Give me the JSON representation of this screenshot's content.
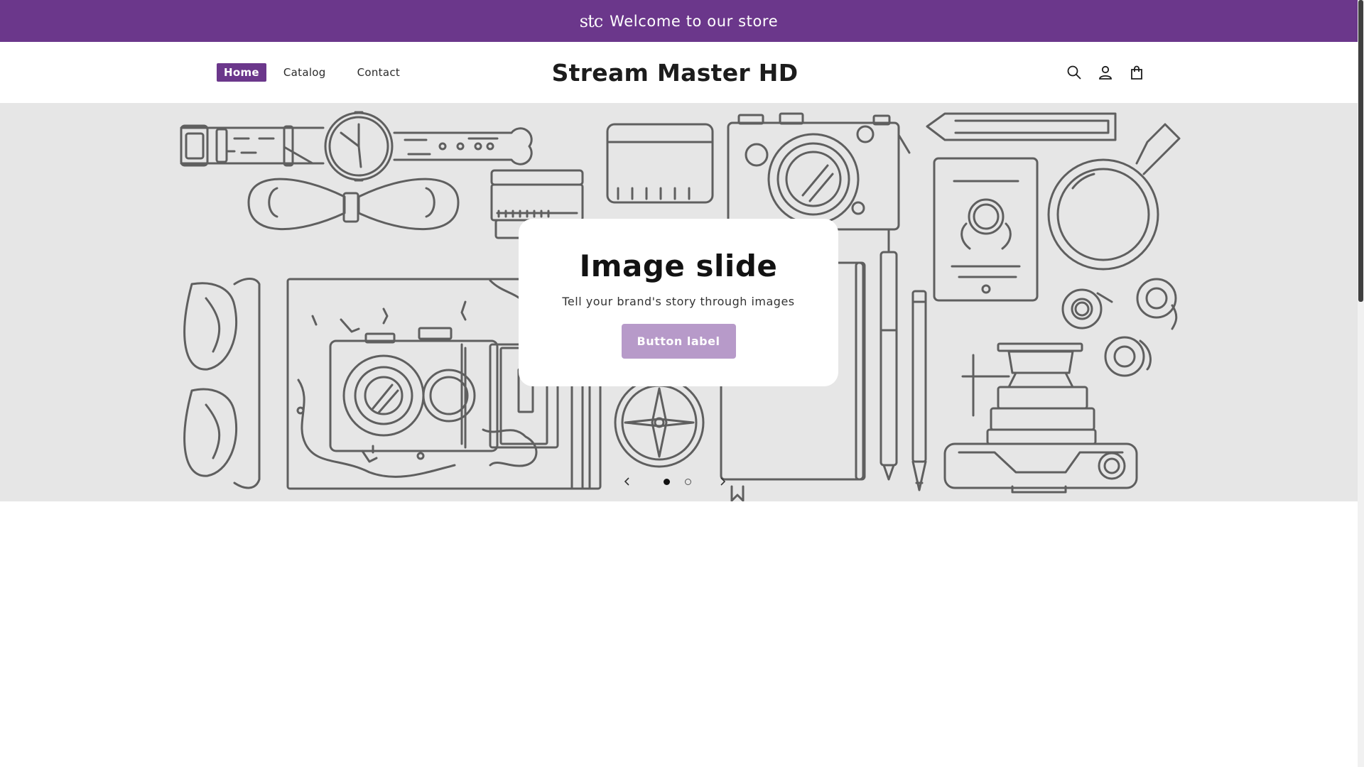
{
  "announcement": {
    "logo": "stc",
    "text": "Welcome to our store"
  },
  "header": {
    "nav": [
      "Home",
      "Catalog",
      "Contact"
    ],
    "active_nav": "Home",
    "store_name": "Stream Master HD",
    "icons": [
      "search-icon",
      "account-icon",
      "cart-icon"
    ]
  },
  "slideshow": {
    "heading": "Image slide",
    "subheading": "Tell your brand's story through images",
    "button_label": "Button label",
    "total_slides": 2,
    "current_slide": 1
  },
  "colors": {
    "brand": "#6b378b",
    "button": "#b79ac9",
    "banner_bg": "#e6e6e6",
    "line_art": "#5f5f5f"
  }
}
